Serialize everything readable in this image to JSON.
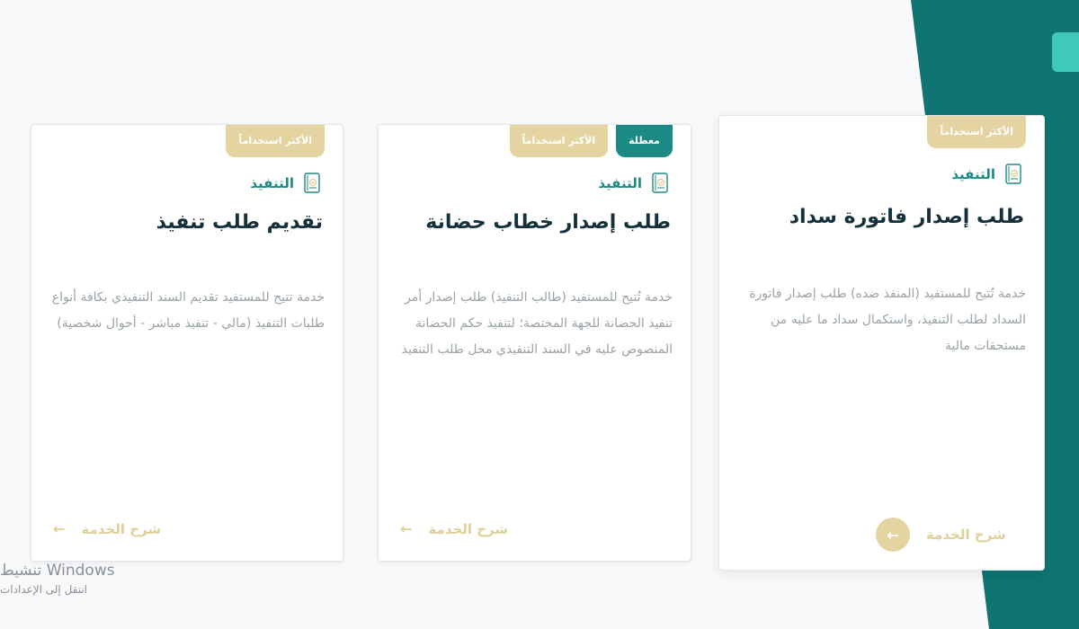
{
  "theme": {
    "teal": "#0f7472",
    "teal_light": "#3fc9bd",
    "gold": "#e3d4a2",
    "badge_disabled": "#1c8a84"
  },
  "cards": [
    {
      "badges": {
        "popular": "الأكثر استخداماً"
      },
      "category": "التنفيذ",
      "category_icon": "document-check-icon",
      "title": "طلب إصدار فاتورة سداد",
      "description": "خدمة تُتيح للمستفيد (المنفذ ضده) طلب إصدار فاتورة السداد لطلب التنفيذ، واستكمال سداد ما عليه من مستحقات مالية",
      "action_label": "شرح الخدمة",
      "action_icon": "arrow-left-icon"
    },
    {
      "badges": {
        "popular": "الأكثر استخداماً",
        "status": "معطلة"
      },
      "category": "التنفيذ",
      "category_icon": "document-check-icon",
      "title": "طلب إصدار خطاب حضانة",
      "description": "خدمة تُتيح للمستفيد (طالب التنفيذ) طلب إصدار أمر تنفيذ الحضانة للجهة المختصة؛ لتنفيذ حكم الحضانة المنصوص عليه في السند التنفيذي محل طلب التنفيذ",
      "action_label": "شرح الخدمة",
      "action_icon": "arrow-left-icon"
    },
    {
      "badges": {
        "popular": "الأكثر استخداماً"
      },
      "category": "التنفيذ",
      "category_icon": "document-check-icon",
      "title": "تقديم طلب تنفيذ",
      "description": "خدمة تتيح للمستفيد تقديم السند التنفيذي بكافة أنواع طلبات التنفيذ (مالي - تنفيذ مباشر - أحوال شخصية)",
      "action_label": "شرح الخدمة",
      "action_icon": "arrow-left-icon"
    }
  ],
  "watermark": {
    "line1": "تنشيط Windows",
    "line2": "انتقل إلى الإعدادات"
  }
}
